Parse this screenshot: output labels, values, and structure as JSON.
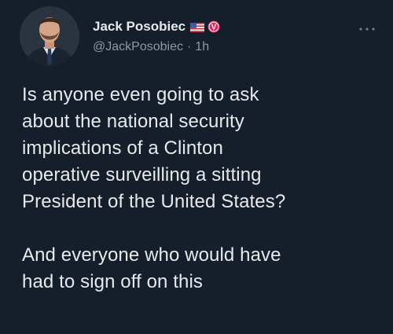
{
  "author": {
    "display_name": "Jack Posobiec",
    "handle": "@JackPosobiec",
    "separator": "·",
    "time": "1h",
    "flag_icon": "us-flag-icon",
    "badge_icon": "red-v-badge-icon",
    "badge_color": "#e0245e"
  },
  "tweet": {
    "paragraphs": [
      "Is anyone even going to ask\nabout the national security\nimplications of a Clinton\noperative surveilling a sitting\nPresident of the United States?",
      "And everyone who would have\nhad to sign off on this"
    ]
  },
  "colors": {
    "background": "#151f2b",
    "text": "#e7e9ea",
    "secondary_text": "#8b98a5"
  }
}
